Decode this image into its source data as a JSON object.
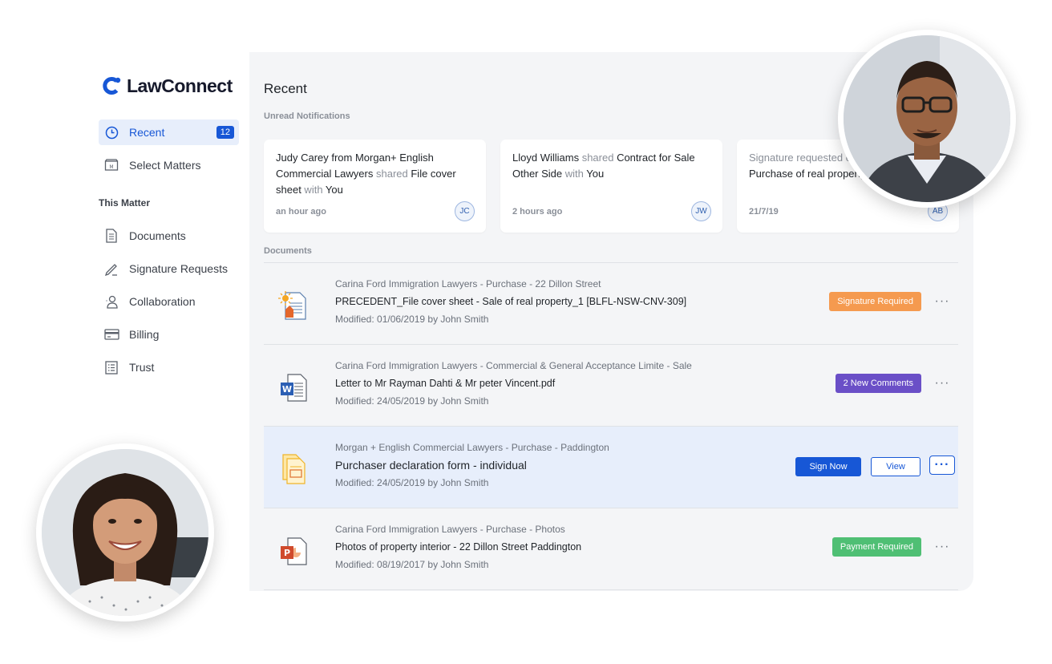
{
  "brand": {
    "name": "LawConnect",
    "accent": "#1757d6"
  },
  "sidebar": {
    "nav": [
      {
        "label": "Recent",
        "badge": "12",
        "icon": "clock-icon"
      },
      {
        "label": "Select Matters",
        "icon": "matters-icon"
      }
    ],
    "section_title": "This Matter",
    "matter_items": [
      {
        "label": "Documents",
        "icon": "documents-icon"
      },
      {
        "label": "Signature Requests",
        "icon": "pen-icon"
      },
      {
        "label": "Collaboration",
        "icon": "person-icon"
      },
      {
        "label": "Billing",
        "icon": "card-icon"
      },
      {
        "label": "Trust",
        "icon": "list-icon"
      }
    ]
  },
  "main": {
    "title": "Recent",
    "notifications_title": "Unread Notifications",
    "notifications": [
      {
        "parts": [
          [
            "Judy Carey from Morgan+ English Commercial Lawyers",
            false
          ],
          [
            " shared ",
            true
          ],
          [
            "File cover sheet",
            false
          ],
          [
            " with ",
            true
          ],
          [
            "You",
            false
          ]
        ],
        "time": "an hour ago",
        "initials": "JC"
      },
      {
        "parts": [
          [
            "Lloyd Williams",
            false
          ],
          [
            " shared ",
            true
          ],
          [
            "Contract for Sale Other Side",
            false
          ],
          [
            " with ",
            true
          ],
          [
            "You",
            false
          ]
        ],
        "time": "2 hours ago",
        "initials": "JW"
      },
      {
        "parts": [
          [
            "Signature requested o",
            true
          ],
          [
            "Purchase of real property",
            false
          ]
        ],
        "time": "21/7/19",
        "initials": "AB"
      }
    ],
    "documents_title": "Documents",
    "documents": [
      {
        "org": "Carina Ford Immigration Lawyers  - Purchase - 22 Dillon Street",
        "name": "PRECEDENT_File cover sheet - Sale of real property_1 [BLFL-NSW-CNV-309]",
        "modified": "Modified: 01/06/2019 by John Smith",
        "icon": "precedent-file-icon",
        "tag": "Signature Required",
        "tag_color": "#f59a4f"
      },
      {
        "org": "Carina Ford Immigration Lawyers - Commercial & General Acceptance Limite - Sale",
        "name": "Letter to Mr Rayman Dahti & Mr peter Vincent.pdf",
        "modified": "Modified: 24/05/2019 by John Smith",
        "icon": "word-file-icon",
        "tag": "2 New Comments",
        "tag_color": "#6a4fc7"
      },
      {
        "org": "Morgan + English Commercial Lawyers - Purchase - Paddington",
        "name": "Purchaser declaration form - individual",
        "modified": "Modified: 24/05/2019 by John Smith",
        "icon": "form-file-icon",
        "primary_action": "Sign Now",
        "secondary_action": "View"
      },
      {
        "org": "Carina Ford Immigration Lawyers - Purchase - Photos",
        "name": "Photos of property interior - 22 Dillon Street Paddington",
        "modified": "Modified: 08/19/2017 by John Smith",
        "icon": "powerpoint-file-icon",
        "tag": "Payment Required",
        "tag_color": "#4fbf74"
      }
    ],
    "more_glyph": "···"
  }
}
